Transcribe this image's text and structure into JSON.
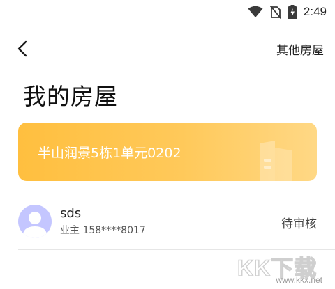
{
  "status_bar": {
    "time": "2:49",
    "icons": [
      "wifi-icon",
      "no-sim-icon",
      "battery-charging-icon"
    ]
  },
  "nav": {
    "back_icon": "chevron-left-icon",
    "other_houses_label": "其他房屋"
  },
  "page": {
    "title": "我的房屋"
  },
  "house_card": {
    "name": "半山润景5栋1单元0202",
    "icon": "building-icon",
    "gradient_colors": [
      "#ffbf3f",
      "#ffd885"
    ]
  },
  "member": {
    "name": "sds",
    "role_phone": "业主 158****8017",
    "status": "待审核",
    "avatar_color": "#c4c6ff"
  },
  "watermark": {
    "mark": "KK下载",
    "url": "www.kkx.net"
  }
}
